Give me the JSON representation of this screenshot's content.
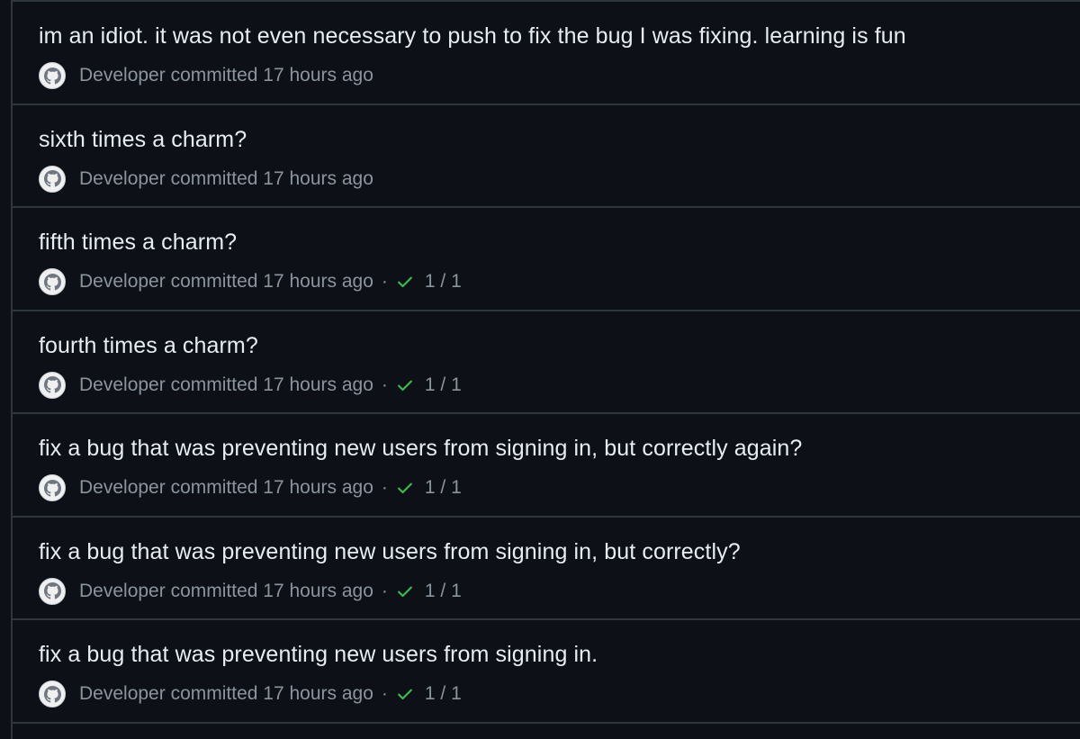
{
  "commits": [
    {
      "title": "im an idiot. it was not even necessary to push to fix the bug I was fixing. learning is fun",
      "author": "Developer",
      "action": "committed",
      "time": "17 hours ago",
      "checks": ""
    },
    {
      "title": "sixth times a charm?",
      "author": "Developer",
      "action": "committed",
      "time": "17 hours ago",
      "checks": ""
    },
    {
      "title": "fifth times a charm?",
      "author": "Developer",
      "action": "committed",
      "time": "17 hours ago",
      "checks": "1 / 1"
    },
    {
      "title": "fourth times a charm?",
      "author": "Developer",
      "action": "committed",
      "time": "17 hours ago",
      "checks": "1 / 1"
    },
    {
      "title": "fix a bug that was preventing new users from signing in, but correctly again?",
      "author": "Developer",
      "action": "committed",
      "time": "17 hours ago",
      "checks": "1 / 1"
    },
    {
      "title": "fix a bug that was preventing new users from signing in, but correctly?",
      "author": "Developer",
      "action": "committed",
      "time": "17 hours ago",
      "checks": "1 / 1"
    },
    {
      "title": "fix a bug that was preventing new users from signing in.",
      "author": "Developer",
      "action": "committed",
      "time": "17 hours ago",
      "checks": "1 / 1"
    }
  ],
  "separator": "·",
  "icons": {
    "avatar": "github-mark-icon",
    "status": "check-icon"
  },
  "colors": {
    "background": "#0d1117",
    "border": "#30363d",
    "title": "#e6edf3",
    "muted": "#8b949e",
    "success": "#3fb950"
  }
}
